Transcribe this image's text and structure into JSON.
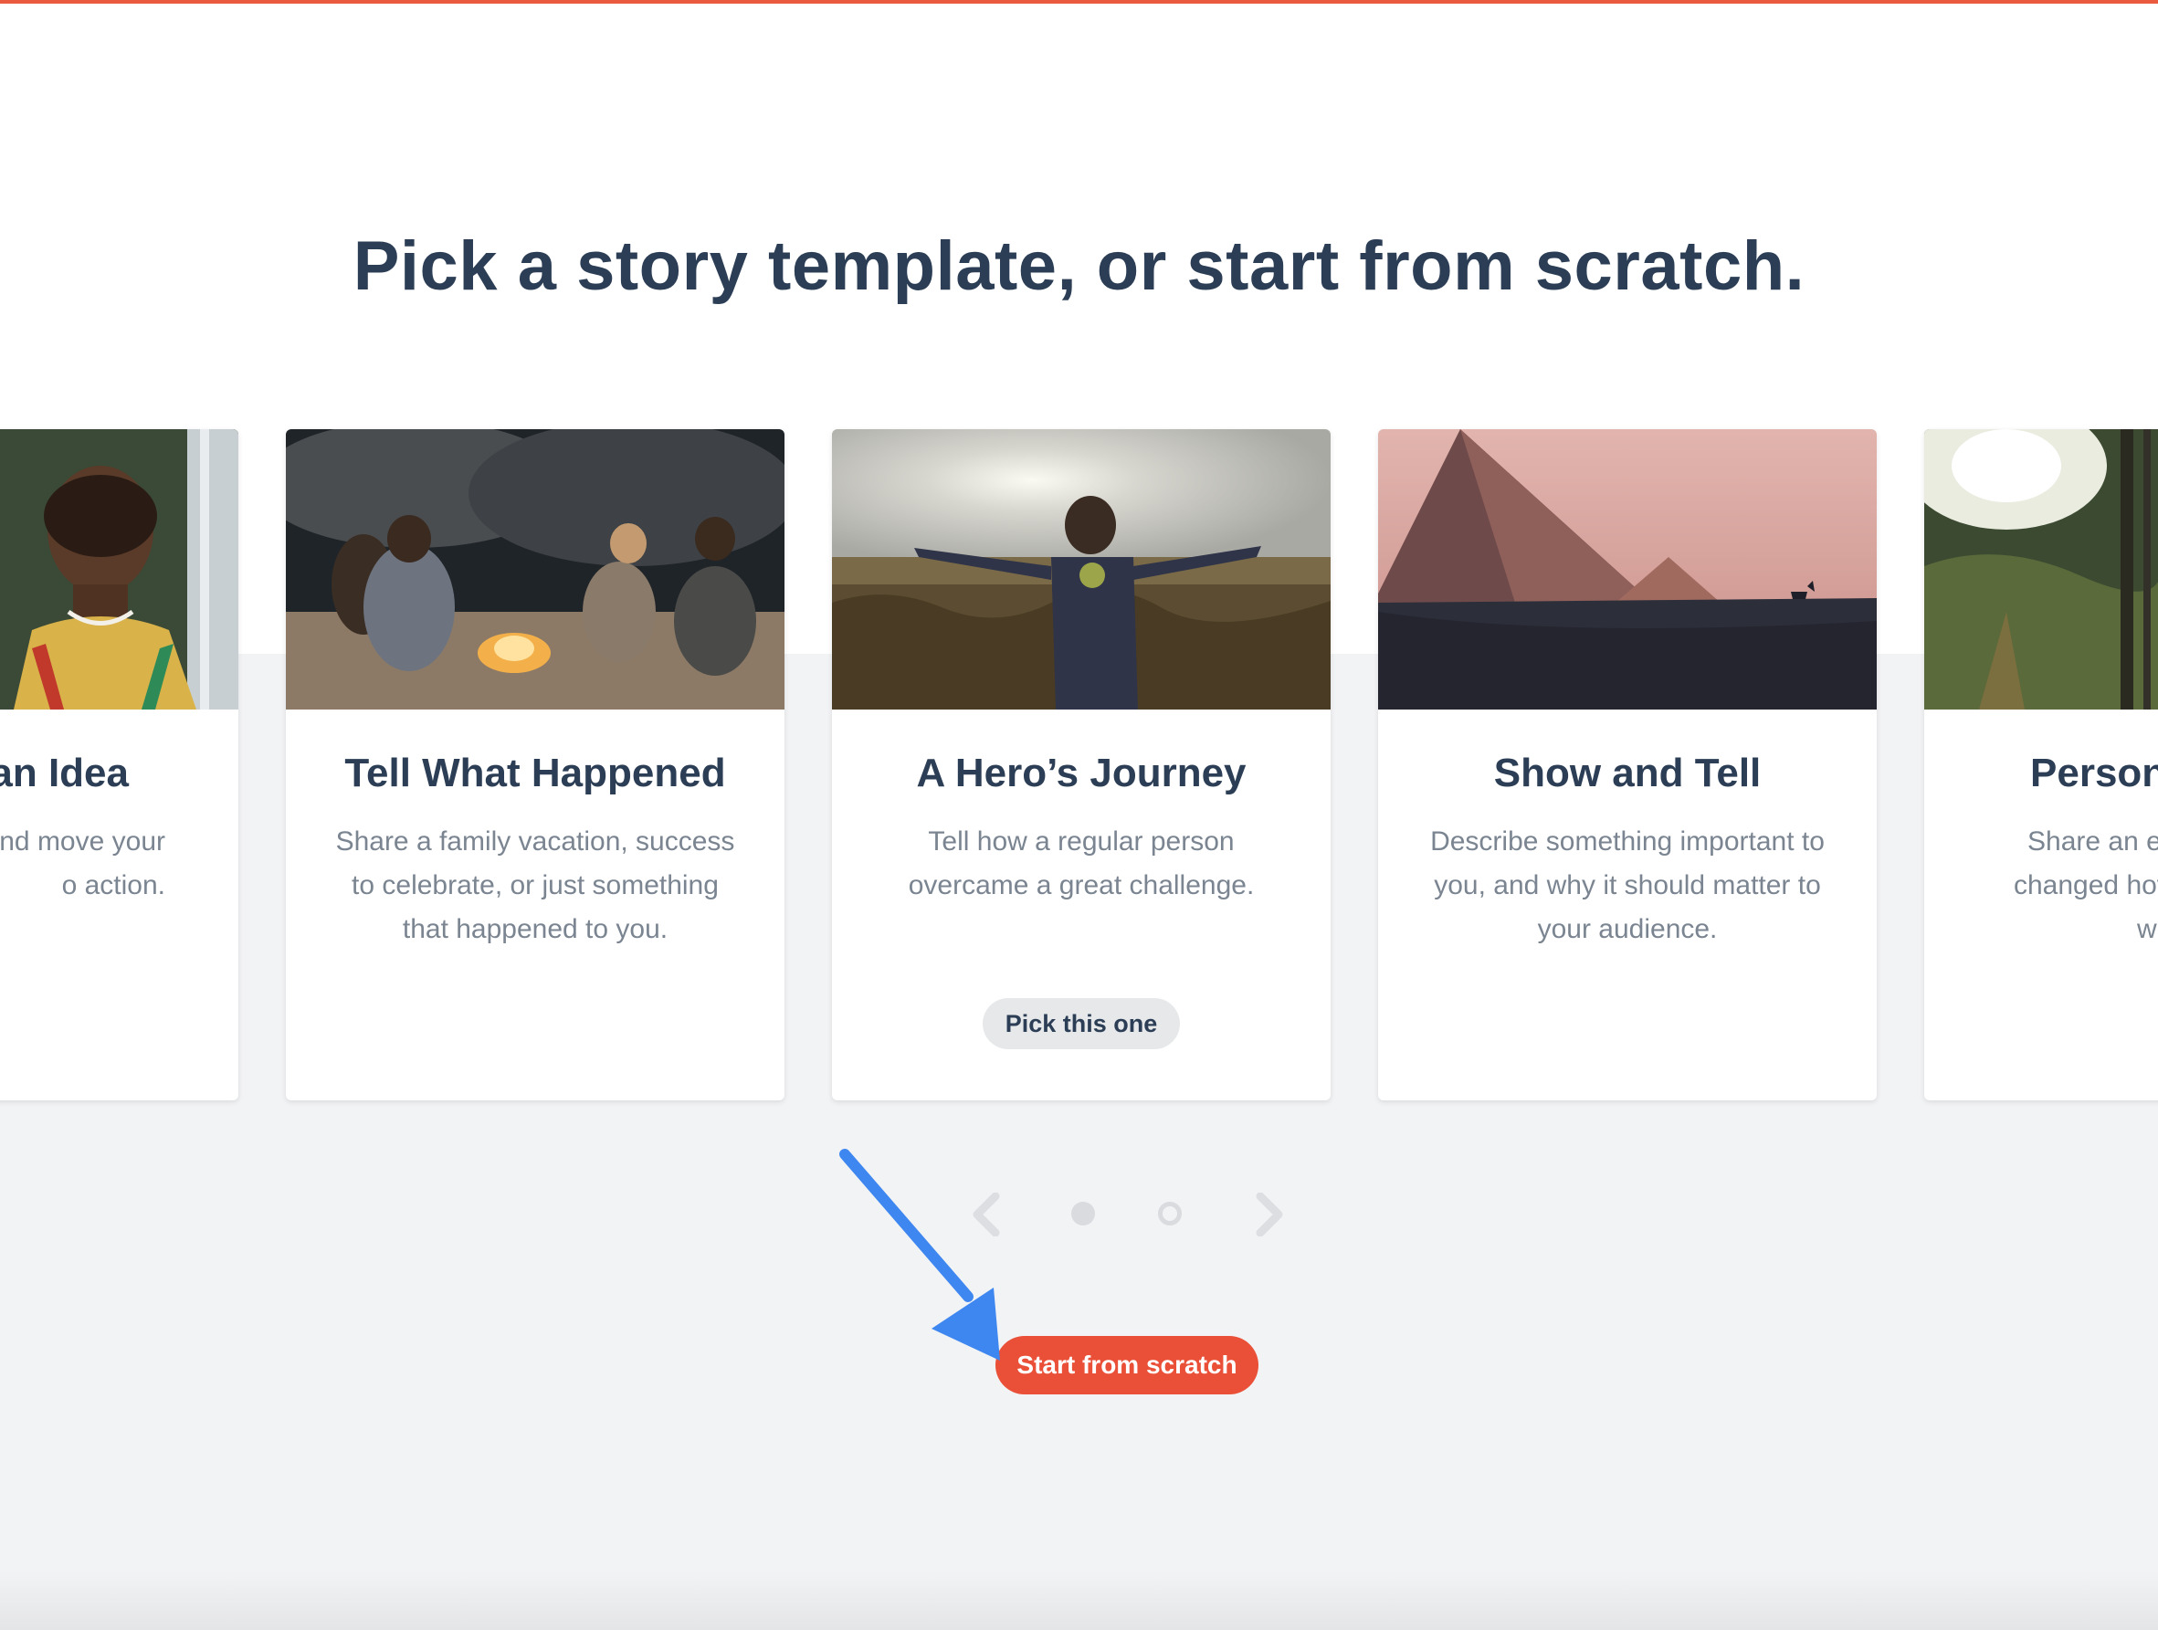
{
  "heading": "Pick a story template, or start from scratch.",
  "cards": [
    {
      "title": "an Idea",
      "desc_lines": [
        "nd move your",
        "o action."
      ]
    },
    {
      "title": "Tell What Happened",
      "desc_lines": [
        "Share a family vacation, success",
        "to celebrate, or just something",
        "that happened to you."
      ]
    },
    {
      "title": "A Hero’s Journey",
      "desc_lines": [
        "Tell how a regular person",
        "overcame a great challenge."
      ],
      "button": "Pick this one"
    },
    {
      "title": "Show and Tell",
      "desc_lines": [
        "Describe something important to",
        "you, and why it should matter to",
        "your audience."
      ]
    },
    {
      "title": "Persona",
      "desc_lines": [
        "Share an ex",
        "changed hov",
        "w"
      ]
    }
  ],
  "carousel": {
    "prev_icon": "chevron-left-icon",
    "next_icon": "chevron-right-icon",
    "pages": 2,
    "current_page": 1
  },
  "start_button": "Start from scratch",
  "colors": {
    "accent": "#ea4f37",
    "heading": "#2c3e55",
    "body_text": "#7a8591",
    "annotation_arrow": "#3f87f0"
  }
}
